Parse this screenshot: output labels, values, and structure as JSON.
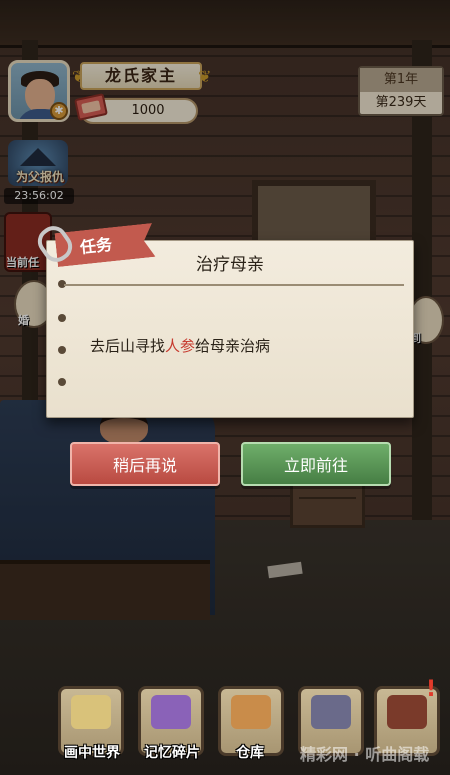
{
  "player": {
    "title": "龙氏家主",
    "money": "1000"
  },
  "date": {
    "year": "第1年",
    "day": "第239天"
  },
  "event": {
    "label": "为父报仇",
    "timer": "23:56:02"
  },
  "side_tabs": {
    "left_1": "当前任",
    "left_2": "婚",
    "right_1": "到"
  },
  "quest": {
    "tab_label": "任务",
    "title": "治疗母亲",
    "body_before": "去后山寻找",
    "body_highlight": "人参",
    "body_after": "给母亲治病",
    "later_label": "稍后再说",
    "go_label": "立即前往"
  },
  "nav": [
    {
      "label": "画中世界",
      "icon": "scroll-icon"
    },
    {
      "label": "记忆碎片",
      "icon": "puzzle-icon"
    },
    {
      "label": "仓库",
      "icon": "warehouse-icon"
    },
    {
      "label": "",
      "icon": "family-icon"
    },
    {
      "label": "",
      "icon": "door-icon"
    }
  ],
  "watermark": "精彩网 · 听曲阁载",
  "colors": {
    "later_button": "#c65a50",
    "go_button": "#5a965a",
    "highlight": "#c63a2e",
    "quest_tab": "#c25a4e"
  }
}
